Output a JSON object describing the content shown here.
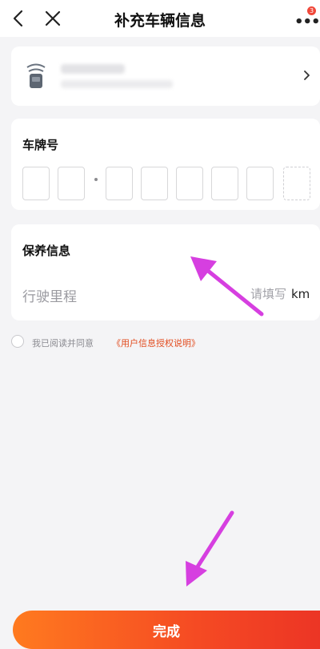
{
  "header": {
    "title": "补充车辆信息",
    "back_icon": "chevron-left-icon",
    "close_icon": "close-icon",
    "more_icon": "more-dots-icon",
    "notification_badge_count": "3"
  },
  "plate": {
    "label": "车牌号"
  },
  "maintenance": {
    "title": "保养信息",
    "mileage_label": "行驶里程",
    "mileage_placeholder": "请填写",
    "mileage_unit": "km"
  },
  "agreement": {
    "text": "我已阅读并同意",
    "link": "《用户信息授权说明》"
  },
  "footer": {
    "done_label": "完成"
  },
  "colors": {
    "accent": "#f54a23",
    "annotation_arrow": "#d63fe0"
  }
}
